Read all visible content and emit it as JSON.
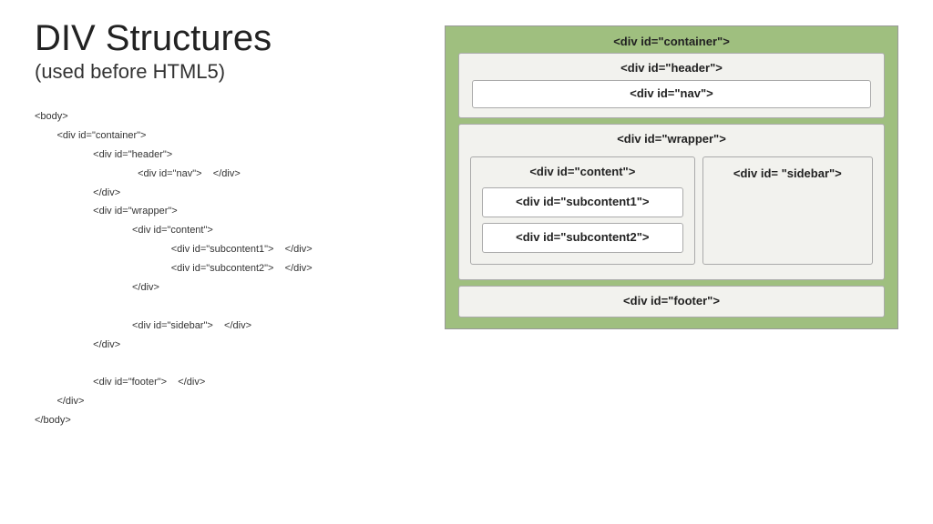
{
  "title": "DIV Structures",
  "subtitle": "(used before HTML5)",
  "code": "<body>\n        <div id=\"container\">\n                     <div id=\"header\">\n                                     <div id=\"nav\">    </div>\n                     </div>\n                     <div id=\"wrapper\">\n                                   <div id=\"content\">\n                                                 <div id=\"subcontent1\">    </div>\n                                                 <div id=\"subcontent2\">    </div>\n                                   </div>\n\n                                   <div id=\"sidebar\">    </div>\n                     </div>\n\n                     <div id=\"footer\">    </div>\n        </div>\n</body>",
  "diagram": {
    "container": "<div id=\"container\">",
    "header": "<div id=\"header\">",
    "nav": "<div id=\"nav\">",
    "wrapper": "<div id=\"wrapper\">",
    "content": "<div id=\"content\">",
    "subcontent1": "<div id=\"subcontent1\">",
    "subcontent2": "<div id=\"subcontent2\">",
    "sidebar": "<div id= \"sidebar\">",
    "footer": "<div id=\"footer\">"
  }
}
